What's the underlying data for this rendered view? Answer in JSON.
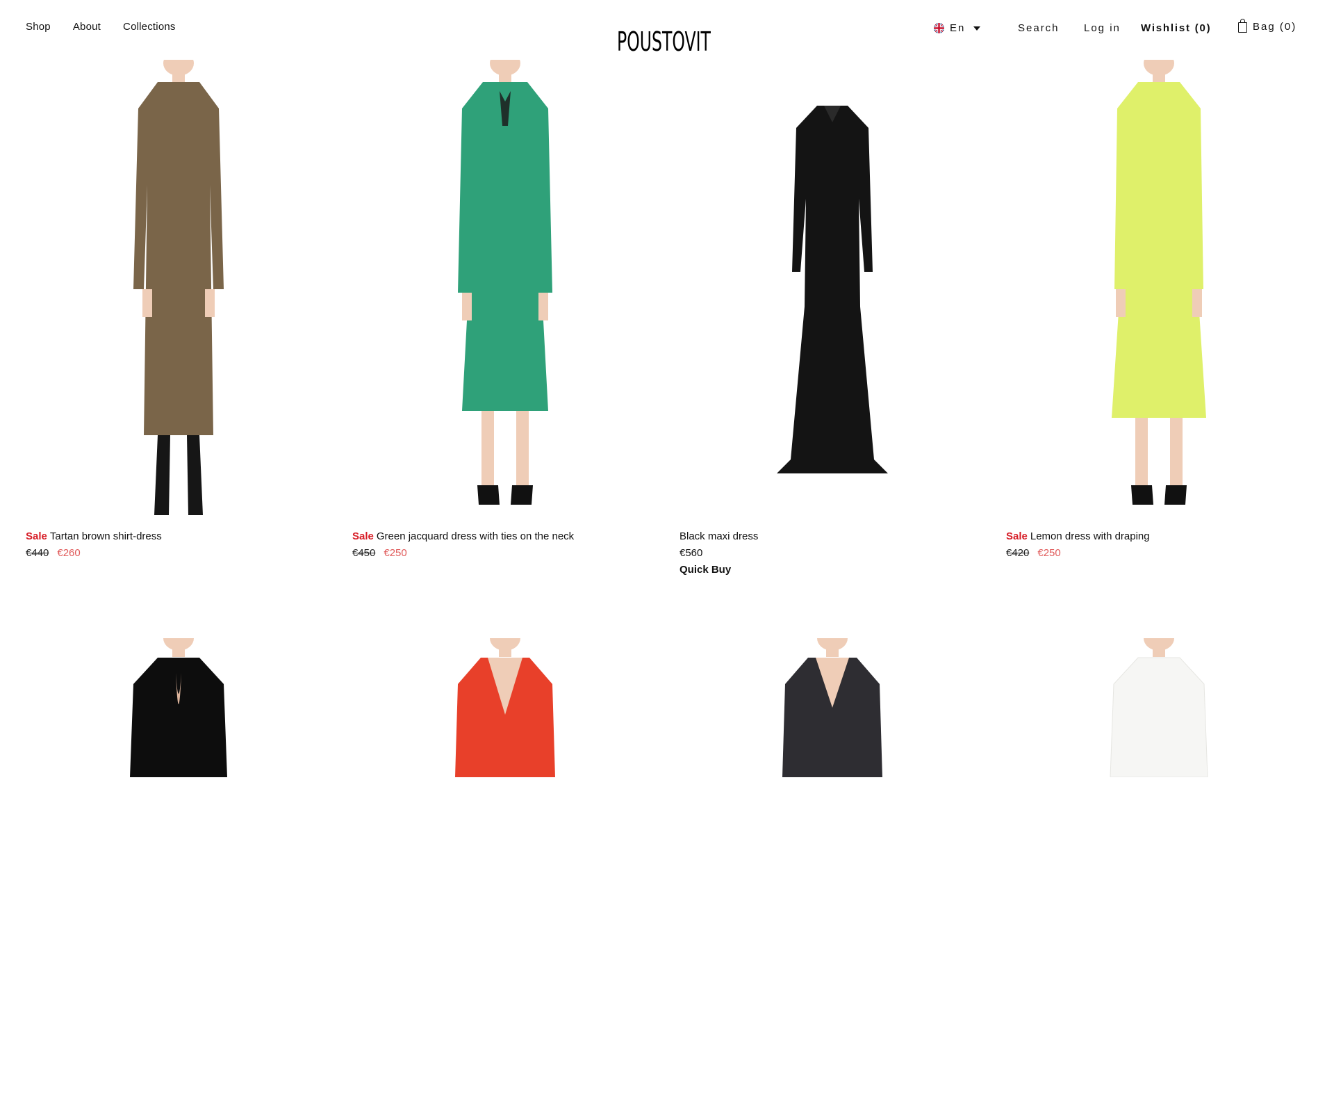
{
  "header": {
    "nav": [
      "Shop",
      "About",
      "Collections"
    ],
    "logo": "POUSTOVIT",
    "language": "En",
    "search": "Search",
    "login": "Log in",
    "wishlist": "Wishlist (0)",
    "bag": "Bag (0)"
  },
  "colors": {
    "sale": "#d71e28",
    "sale_price": "#e05a5a",
    "text": "#111111"
  },
  "products": [
    {
      "sale_label": "Sale",
      "name": "Tartan brown shirt-dress",
      "old_price": "€440",
      "new_price": "€260",
      "dress_color": "#7a6549"
    },
    {
      "sale_label": "Sale",
      "name": "Green jacquard dress with ties on the neck",
      "old_price": "€450",
      "new_price": "€250",
      "dress_color": "#2fa179"
    },
    {
      "name": "Black maxi dress",
      "price": "€560",
      "quick_buy": "Quick Buy",
      "dress_color": "#141414"
    },
    {
      "sale_label": "Sale",
      "name": "Lemon dress with draping",
      "old_price": "€420",
      "new_price": "€250",
      "dress_color": "#dff06a"
    },
    {
      "dress_color": "#0d0d0d"
    },
    {
      "dress_color": "#e8402a"
    },
    {
      "dress_color": "#2e2d32"
    },
    {
      "dress_color": "#f6f6f4"
    }
  ]
}
